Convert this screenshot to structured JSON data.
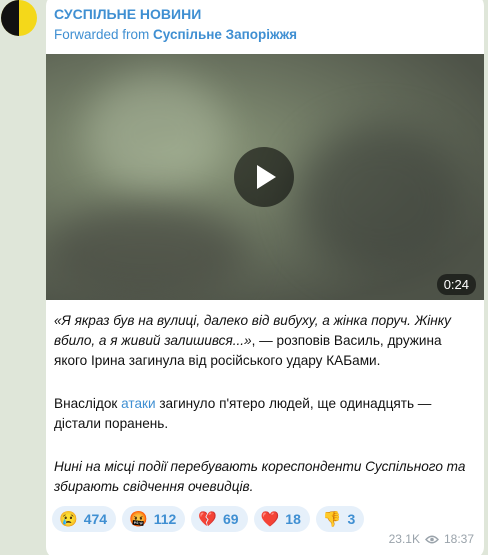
{
  "channel": {
    "name": "СУСПІЛЬНЕ НОВИНИ",
    "forwarded_prefix": "Forwarded from ",
    "forwarded_source": "Суспільне Запоріжжя"
  },
  "video": {
    "duration": "0:24"
  },
  "message": {
    "p1_italic": "«Я якраз був на вулиці, далеко від вибуху, а жінка поруч. Жінку вбило, а я живий залишився...»",
    "p1_rest": ", — розповів Василь, дружина якого Ірина загинула від російського удару КАБами.",
    "p2_before": "Внаслідок ",
    "p2_link": "атаки",
    "p2_after": " загинуло п'ятеро людей, ще одинадцять — дістали поранень.",
    "p3_italic": "Нині на місці події перебувають кореспонденти Суспільного та збирають свідчення очевидців."
  },
  "reactions": [
    {
      "emoji": "😢",
      "icon": "crying-face-icon",
      "count": "474"
    },
    {
      "emoji": "🤬",
      "icon": "cursing-face-icon",
      "count": "112"
    },
    {
      "emoji": "💔",
      "icon": "broken-heart-icon",
      "count": "69"
    },
    {
      "emoji": "❤️",
      "icon": "red-heart-icon",
      "count": "18"
    },
    {
      "emoji": "👎",
      "icon": "thumbs-down-icon",
      "count": "3"
    }
  ],
  "meta": {
    "views": "23.1K",
    "time": "18:37"
  },
  "colors": {
    "accent": "#3f8fd2",
    "background": "#dfe6d9",
    "bubble": "#ffffff"
  }
}
